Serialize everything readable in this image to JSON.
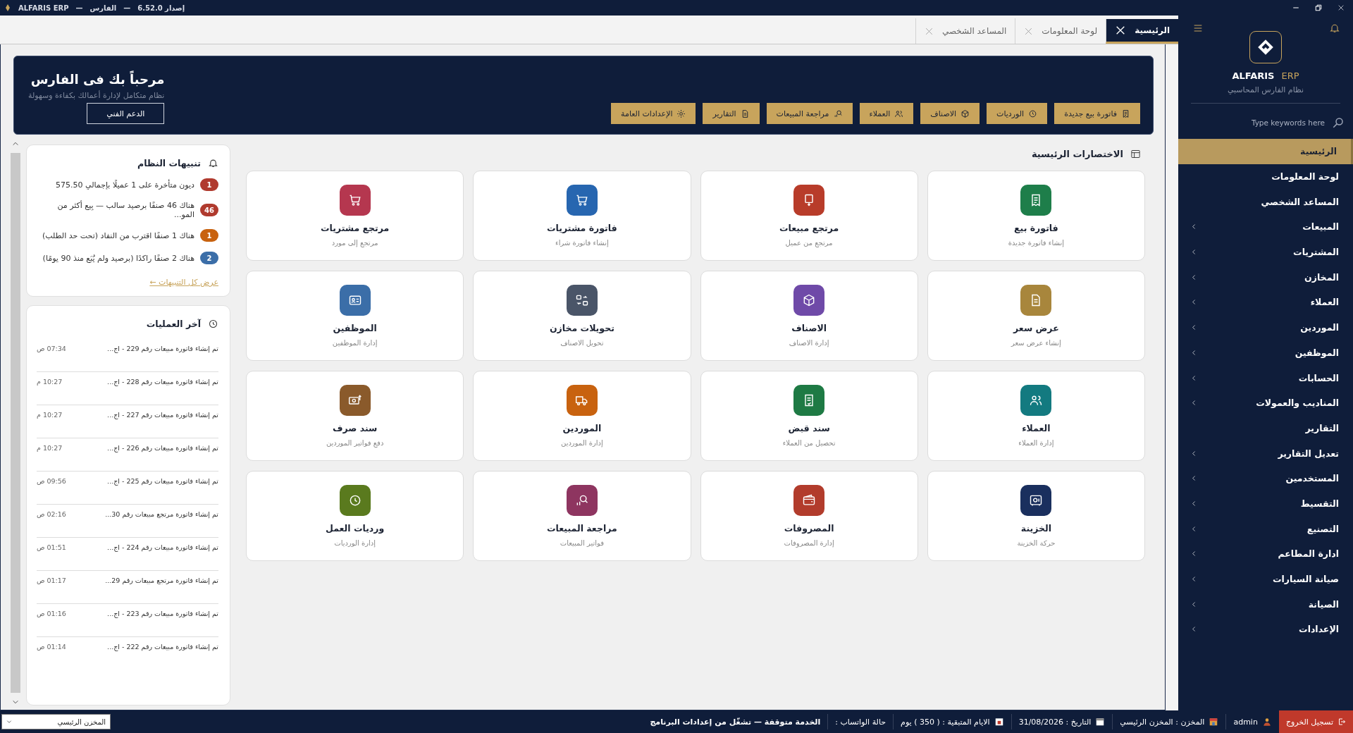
{
  "title_bar": {
    "parts": [
      "إصدار 6.52.0",
      "—",
      "الفارس",
      "—",
      "ALFARIS ERP"
    ]
  },
  "tabs": [
    {
      "label": "الرئيسية",
      "selected": true
    },
    {
      "label": "لوحة المعلومات",
      "selected": false
    },
    {
      "label": "المساعد الشخصي",
      "selected": false
    }
  ],
  "banner": {
    "title": "مرحباً بك فى الفارس",
    "subtitle": "نظام متكامل لإدارة أعمالك بكفاءة وسهولة",
    "support_button": "الدعم الفني",
    "quick_buttons": [
      "فاتورة بيع جديدة",
      "الورديات",
      "الاصناف",
      "العملاء",
      "مراجعة المبيعات",
      "التقارير",
      "الإعدادات العامة"
    ]
  },
  "alerts": {
    "title": "تنبيهات النظام",
    "items": [
      {
        "count": "1",
        "color": "#b03a2e",
        "text": "ديون متأخرة على 1 عميلًا بإجمالي 575.50"
      },
      {
        "count": "46",
        "color": "#b03a2e",
        "text": "هناك 46 صنفًا برصيد سالب — بِيع أكثر من المو..."
      },
      {
        "count": "1",
        "color": "#c8620f",
        "text": "هناك 1 صنفًا اقترب من النفاد (تحت حد الطلب)"
      },
      {
        "count": "2",
        "color": "#3b6ea8",
        "text": "هناك 2 صنفًا راكدًا (برصيد ولم يُبَع منذ 90 يومًا)"
      }
    ],
    "link": "عرض كل التنبيهات ←"
  },
  "activity": {
    "title": "آخر العمليات",
    "items": [
      {
        "time": "07:34 ص",
        "text": "تم إنشاء فاتورة مبيعات رقم 229 - اج..."
      },
      {
        "time": "10:27 م",
        "text": "تم إنشاء فاتورة مبيعات رقم 228 - اج..."
      },
      {
        "time": "10:27 م",
        "text": "تم إنشاء فاتورة مبيعات رقم 227 - اج..."
      },
      {
        "time": "10:27 م",
        "text": "تم إنشاء فاتورة مبيعات رقم 226 - اج..."
      },
      {
        "time": "09:56 ص",
        "text": "تم إنشاء فاتورة مبيعات رقم 225 - اج..."
      },
      {
        "time": "02:16 ص",
        "text": "تم إنشاء فاتورة مرتجع مبيعات رقم 30..."
      },
      {
        "time": "01:51 ص",
        "text": "تم إنشاء فاتورة مبيعات رقم 224 - اج..."
      },
      {
        "time": "01:17 ص",
        "text": "تم إنشاء فاتورة مرتجع مبيعات رقم 29..."
      },
      {
        "time": "01:16 ص",
        "text": "تم إنشاء فاتورة مبيعات رقم 223 - اج..."
      },
      {
        "time": "01:14 ص",
        "text": "تم إنشاء فاتورة مبيعات رقم 222 - اج..."
      }
    ]
  },
  "shortcuts": {
    "title": "الاختصارات الرئيسية",
    "items": [
      {
        "title": "فاتورة بيع",
        "subtitle": "إنشاء فاتورة جديدة",
        "color": "#1e7e4a"
      },
      {
        "title": "مرتجع مبيعات",
        "subtitle": "مرتجع من عميل",
        "color": "#b83c2a"
      },
      {
        "title": "فاتورة مشتريات",
        "subtitle": "إنشاء فاتورة شراء",
        "color": "#2766b0"
      },
      {
        "title": "مرتجع مشتريات",
        "subtitle": "مرتجع إلى مورد",
        "color": "#b5374f"
      },
      {
        "title": "عرض سعر",
        "subtitle": "إنشاء عرض سعر",
        "color": "#a8863c"
      },
      {
        "title": "الاصناف",
        "subtitle": "إدارة الاصناف",
        "color": "#6f4aa8"
      },
      {
        "title": "تحويلات مخازن",
        "subtitle": "تحويل الاصناف",
        "color": "#4a5568"
      },
      {
        "title": "الموظفين",
        "subtitle": "إدارة الموظفين",
        "color": "#3b6ea8"
      },
      {
        "title": "العملاء",
        "subtitle": "إدارة العملاء",
        "color": "#137a80"
      },
      {
        "title": "سند قبض",
        "subtitle": "تحصيل من العملاء",
        "color": "#1e7a44"
      },
      {
        "title": "الموردين",
        "subtitle": "إدارة الموردين",
        "color": "#c8620f"
      },
      {
        "title": "سند صرف",
        "subtitle": "دفع فواتير الموردين",
        "color": "#8a5a2b"
      },
      {
        "title": "الخزينة",
        "subtitle": "حركة الخزينة",
        "color": "#1a2f5e"
      },
      {
        "title": "المصروفات",
        "subtitle": "إدارة المصروفات",
        "color": "#b23c2c"
      },
      {
        "title": "مراجعة المبيعات",
        "subtitle": "فواتير المبيعات",
        "color": "#8e3560"
      },
      {
        "title": "ورديات العمل",
        "subtitle": "إدارة الورديات",
        "color": "#5a7a1e"
      }
    ]
  },
  "sidebar": {
    "brand": "ALFARIS",
    "brand_suffix": "ERP",
    "subtitle": "نظام الفارس المحاسبي",
    "search": {
      "placeholder": "Type keywords here"
    },
    "items": [
      {
        "label": "الرئيسية",
        "selected": true,
        "has_submenu": false
      },
      {
        "label": "لوحة المعلومات",
        "selected": false,
        "has_submenu": false
      },
      {
        "label": "المساعد الشخصي",
        "selected": false,
        "has_submenu": false
      },
      {
        "label": "المبيعات",
        "selected": false,
        "has_submenu": true
      },
      {
        "label": "المشتريات",
        "selected": false,
        "has_submenu": true
      },
      {
        "label": "المخازن",
        "selected": false,
        "has_submenu": true
      },
      {
        "label": "العملاء",
        "selected": false,
        "has_submenu": true
      },
      {
        "label": "الموردين",
        "selected": false,
        "has_submenu": true
      },
      {
        "label": "الموظفين",
        "selected": false,
        "has_submenu": true
      },
      {
        "label": "الحسابات",
        "selected": false,
        "has_submenu": true
      },
      {
        "label": "المناديب والعمولات",
        "selected": false,
        "has_submenu": true
      },
      {
        "label": "التقارير",
        "selected": false,
        "has_submenu": false
      },
      {
        "label": "تعديل التقارير",
        "selected": false,
        "has_submenu": true
      },
      {
        "label": "المستخدمين",
        "selected": false,
        "has_submenu": true
      },
      {
        "label": "التقسيط",
        "selected": false,
        "has_submenu": true
      },
      {
        "label": "التصنيع",
        "selected": false,
        "has_submenu": true
      },
      {
        "label": "ادارة المطاعم",
        "selected": false,
        "has_submenu": true
      },
      {
        "label": "صيانة السيارات",
        "selected": false,
        "has_submenu": true
      },
      {
        "label": "الصيانة",
        "selected": false,
        "has_submenu": true
      },
      {
        "label": "الإعدادات",
        "selected": false,
        "has_submenu": true
      }
    ]
  },
  "status_bar": {
    "logout": "تسجيل الخروج",
    "user": "admin",
    "store": "المخزن : المخزن الرئيسي",
    "date": "التاريخ : 31/08/2026",
    "days_left": "الايام المتبقية : ( 350 ) يوم",
    "whatsapp_label": "حالة الواتساب :",
    "whatsapp_status": "الخدمة متوقفة — تشغّل من إعدادات البرنامج",
    "store_select": "المخزن الرئيسي"
  }
}
